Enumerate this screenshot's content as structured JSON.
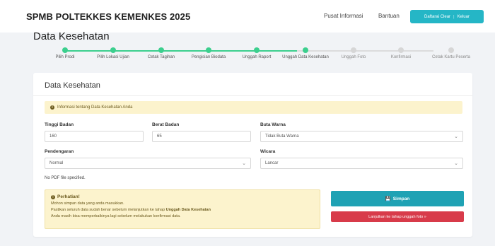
{
  "header": {
    "brand": "SPMB POLTEKKES KEMENKES 2025",
    "nav_pusat_informasi": "Pusat Informasi",
    "nav_bantuan": "Bantuan",
    "user_label": "Daftarai Clear",
    "logout_label": "Keluar"
  },
  "page": {
    "title": "Data Kesehatan"
  },
  "stepper": {
    "steps": [
      {
        "label": "Pilih Prodi",
        "status": "done"
      },
      {
        "label": "Pilih Lokasi Ujian",
        "status": "done"
      },
      {
        "label": "Cetak Tagihan",
        "status": "done"
      },
      {
        "label": "Pengisian Biodata",
        "status": "done"
      },
      {
        "label": "Unggah Raport",
        "status": "done"
      },
      {
        "label": "Unggah Data Kesehatan",
        "status": "current"
      },
      {
        "label": "Unggah Foto",
        "status": "pending"
      },
      {
        "label": "Konfirmasi",
        "status": "pending"
      },
      {
        "label": "Cetak Kartu Peserta",
        "status": "pending"
      }
    ]
  },
  "card": {
    "title": "Data Kesehatan",
    "info_text": "Informasi tentang Data Kesehatan Anda",
    "fields": {
      "tinggi_badan": {
        "label": "Tinggi Badan",
        "value": "160"
      },
      "berat_badan": {
        "label": "Berat Badan",
        "value": "65"
      },
      "buta_warna": {
        "label": "Buta Warna",
        "value": "Tidak Buta Warna"
      },
      "pendengaran": {
        "label": "Pendengaran",
        "value": "Normal"
      },
      "wicara": {
        "label": "Wicara",
        "value": "Lancar"
      }
    },
    "file_status": "No PDF file specified.",
    "warning": {
      "title": "Perhatian!",
      "line1": "Mohon simpan data yang anda masukkan.",
      "line2_prefix": "Pastikan seluruh data sudah benar sebelum melanjutkan ke tahap ",
      "line2_bold": "Unggah Data Kesehatan",
      "line3": "Anda masih bisa memperbaikinya lagi sebelum melakukan konfirmasi data."
    },
    "save_button": "Simpan",
    "next_button": "Lanjutkan ke tahap unggah foto »"
  },
  "colors": {
    "accent": "#25b6c6",
    "save": "#1fa2b4",
    "next": "#d83b4a",
    "step_done": "#3ccf8e",
    "alert_bg": "#fcf3cd"
  }
}
